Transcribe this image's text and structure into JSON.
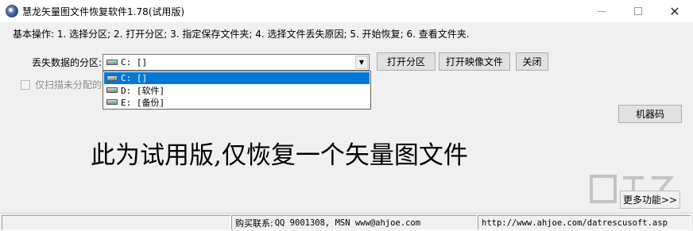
{
  "window": {
    "title": "慧龙矢量图文件恢复软件1.78(试用版)",
    "minimize_label": "—",
    "maximize_label": "☐",
    "close_label": "✕"
  },
  "steps_text": "基本操作: 1. 选择分区; 2. 打开分区; 3. 指定保存文件夹; 4. 选择文件丢失原因; 5. 开始恢复; 6. 查看文件夹.",
  "partition": {
    "label": "丢失数据的分区:",
    "selected": "C: []",
    "options": [
      {
        "label": "C: []",
        "selected": true
      },
      {
        "label": "D: [软件]",
        "selected": false
      },
      {
        "label": "E: [备份]",
        "selected": false
      }
    ]
  },
  "buttons": {
    "open_partition": "打开分区",
    "open_image": "打开映像文件",
    "close": "关闭",
    "machine_code": "机器码",
    "more": "更多功能>>"
  },
  "checkbox": {
    "label": "仅扫描未分配的",
    "checked": false
  },
  "trial_notice": "此为试用版,仅恢复一个矢量图文件",
  "status": {
    "panel1": "",
    "contact_label": "购买联系:",
    "contact_value": "QQ 9001308, MSN www@ahjoe.com",
    "url": "http://www.ahjoe.com/datrescusoft.asp"
  },
  "icons": {
    "app": "app-disc-icon",
    "drive": "drive-icon",
    "dropdown_arrow": "chevron-down-icon"
  },
  "colors": {
    "selection": "#0078d7",
    "button_face": "#e1e1e1",
    "window_bg": "#f0f0f0"
  }
}
